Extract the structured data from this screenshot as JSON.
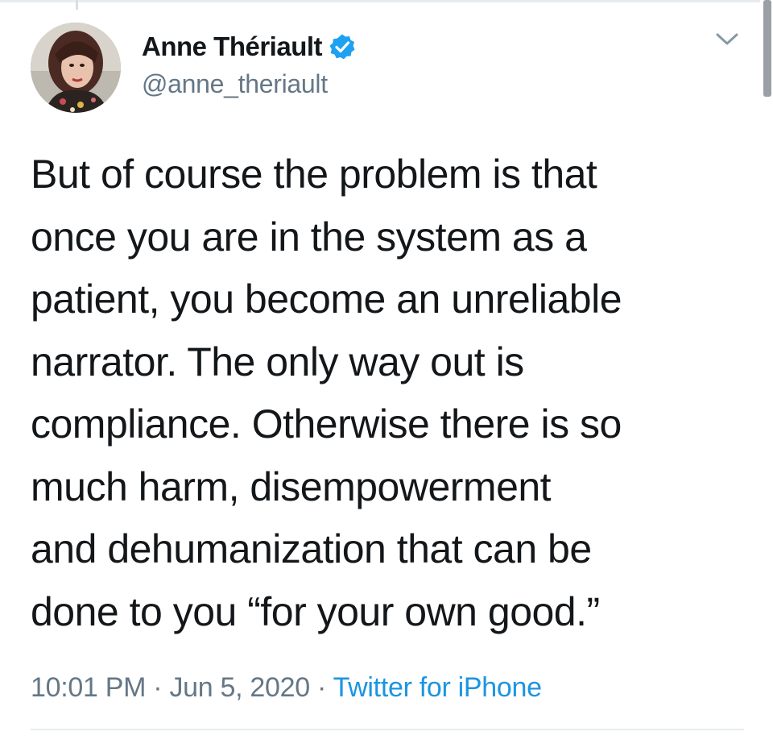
{
  "tweet": {
    "author": {
      "display_name": "Anne Thériault",
      "handle": "@anne_theriault",
      "verified": true,
      "avatar_icon": "avatar-photo"
    },
    "text_lines": [
      "But of course the problem is that",
      "once you are in the system as a",
      "patient, you become an unreliable",
      "narrator. The only way out is",
      "compliance. Otherwise there is so",
      "much harm, disempowerment",
      "and dehumanization that can be",
      "done to you “for your own good.”"
    ],
    "meta": {
      "time": "10:01 PM",
      "date": "Jun 5, 2020",
      "separator": " · ",
      "source": "Twitter for iPhone"
    },
    "menu_icon": "chevron-down-icon"
  },
  "colors": {
    "text_primary": "#14171a",
    "text_secondary": "#657786",
    "link": "#1b95e0",
    "verified_badge": "#1da1f2",
    "divider": "#e6ecf0"
  }
}
